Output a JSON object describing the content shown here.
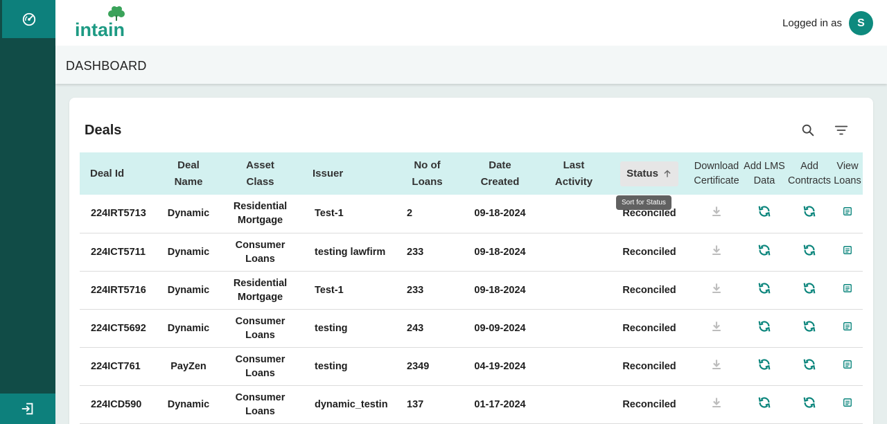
{
  "header": {
    "logo_text": "intain",
    "logged_in_label": "Logged in as",
    "avatar_initial": "S"
  },
  "page": {
    "title": "DASHBOARD"
  },
  "deals": {
    "title": "Deals",
    "tooltip": "Sort for Status",
    "columns": {
      "deal_id": "Deal Id",
      "deal_name_1": "Deal",
      "deal_name_2": "Name",
      "asset_class_1": "Asset",
      "asset_class_2": "Class",
      "issuer": "Issuer",
      "no_loans_1": "No of",
      "no_loans_2": "Loans",
      "date_created_1": "Date",
      "date_created_2": "Created",
      "last_activity_1": "Last",
      "last_activity_2": "Activity",
      "status": "Status",
      "download_1": "Download",
      "download_2": "Certificate",
      "lms_1": "Add LMS",
      "lms_2": "Data",
      "contracts_1": "Add",
      "contracts_2": "Contracts",
      "view_1": "View",
      "view_2": "Loans"
    },
    "rows": [
      {
        "deal_id": "224IRT5713",
        "deal_name": "Dynamic",
        "asset_1": "Residential",
        "asset_2": "Mortgage",
        "issuer": "Test-1",
        "loans": "2",
        "date": "09-18-2024",
        "last_activity": "",
        "status": "Reconciled"
      },
      {
        "deal_id": "224ICT5711",
        "deal_name": "Dynamic",
        "asset_1": "Consumer",
        "asset_2": "Loans",
        "issuer": "testing lawfirm",
        "loans": "233",
        "date": "09-18-2024",
        "last_activity": "",
        "status": "Reconciled"
      },
      {
        "deal_id": "224IRT5716",
        "deal_name": "Dynamic",
        "asset_1": "Residential",
        "asset_2": "Mortgage",
        "issuer": "Test-1",
        "loans": "233",
        "date": "09-18-2024",
        "last_activity": "",
        "status": "Reconciled"
      },
      {
        "deal_id": "224ICT5692",
        "deal_name": "Dynamic",
        "asset_1": "Consumer",
        "asset_2": "Loans",
        "issuer": "testing",
        "loans": "243",
        "date": "09-09-2024",
        "last_activity": "",
        "status": "Reconciled"
      },
      {
        "deal_id": "224ICT761",
        "deal_name": "PayZen",
        "asset_1": "Consumer",
        "asset_2": "Loans",
        "issuer": "testing",
        "loans": "2349",
        "date": "04-19-2024",
        "last_activity": "",
        "status": "Reconciled"
      },
      {
        "deal_id": "224ICD590",
        "deal_name": "Dynamic",
        "asset_1": "Consumer",
        "asset_2": "Loans",
        "issuer": "dynamic_testin",
        "loans": "137",
        "date": "01-17-2024",
        "last_activity": "",
        "status": "Reconciled"
      }
    ]
  },
  "icons": {
    "sidebar_top": "dashboard-icon",
    "sidebar_bottom": "logout-icon",
    "search": "search-icon",
    "filter": "filter-icon",
    "sort": "arrow-up-icon",
    "download": "download-icon",
    "lms": "sync-icon",
    "contracts": "sync-icon",
    "view": "document-icon"
  },
  "colors": {
    "sidebar": "#114c47",
    "sidebar_accent": "#0d807c",
    "header_row": "#d3f1f0",
    "icon_teal": "#0b857c",
    "avatar": "#0e8a7e"
  }
}
